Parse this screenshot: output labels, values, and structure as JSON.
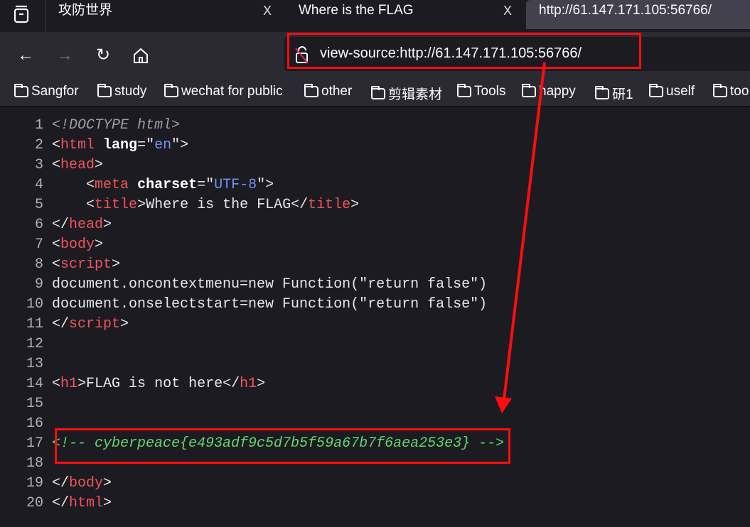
{
  "tabs": [
    {
      "title": "攻防世界",
      "active": false
    },
    {
      "title": "Where is the FLAG",
      "active": false
    },
    {
      "title": "http://61.147.171.105:56766/",
      "active": true
    }
  ],
  "tab_close_glyph": "X",
  "nav": {
    "back_icon": "arrow-left-icon",
    "forward_icon": "arrow-right-icon",
    "reload_icon": "reload-icon",
    "home_icon": "home-icon"
  },
  "address_bar": {
    "value": "view-source:http://61.147.171.105:56766/",
    "icon": "insecure-lock-icon"
  },
  "bookmarks": [
    "Sangfor",
    "study",
    "wechat for public",
    "other",
    "剪辑素材",
    "Tools",
    "happy",
    "研1",
    "uself",
    "too"
  ],
  "source_lines": [
    [
      [
        "doctype",
        "<!DOCTYPE html>"
      ]
    ],
    [
      [
        "punct",
        "<"
      ],
      [
        "tag",
        "html"
      ],
      [
        "text",
        " "
      ],
      [
        "attr",
        "lang"
      ],
      [
        "punct",
        "=\""
      ],
      [
        "val",
        "en"
      ],
      [
        "punct",
        "\">"
      ]
    ],
    [
      [
        "punct",
        "<"
      ],
      [
        "tag",
        "head"
      ],
      [
        "punct",
        ">"
      ]
    ],
    [
      [
        "text",
        "    "
      ],
      [
        "punct",
        "<"
      ],
      [
        "tag",
        "meta"
      ],
      [
        "text",
        " "
      ],
      [
        "attr",
        "charset"
      ],
      [
        "punct",
        "=\""
      ],
      [
        "val",
        "UTF-8"
      ],
      [
        "punct",
        "\">"
      ]
    ],
    [
      [
        "text",
        "    "
      ],
      [
        "punct",
        "<"
      ],
      [
        "tag",
        "title"
      ],
      [
        "punct",
        ">"
      ],
      [
        "text",
        "Where is the FLAG"
      ],
      [
        "punct",
        "</"
      ],
      [
        "tag",
        "title"
      ],
      [
        "punct",
        ">"
      ]
    ],
    [
      [
        "punct",
        "</"
      ],
      [
        "tag",
        "head"
      ],
      [
        "punct",
        ">"
      ]
    ],
    [
      [
        "punct",
        "<"
      ],
      [
        "tag",
        "body"
      ],
      [
        "punct",
        ">"
      ]
    ],
    [
      [
        "punct",
        "<"
      ],
      [
        "tag",
        "script"
      ],
      [
        "punct",
        ">"
      ]
    ],
    [
      [
        "text",
        "document.oncontextmenu=new Function(\"return false\")"
      ]
    ],
    [
      [
        "text",
        "document.onselectstart=new Function(\"return false\")"
      ]
    ],
    [
      [
        "punct",
        "</"
      ],
      [
        "tag",
        "script"
      ],
      [
        "punct",
        ">"
      ]
    ],
    [],
    [],
    [
      [
        "punct",
        "<"
      ],
      [
        "tag",
        "h1"
      ],
      [
        "punct",
        ">"
      ],
      [
        "text",
        "FLAG is not here"
      ],
      [
        "punct",
        "</"
      ],
      [
        "tag",
        "h1"
      ],
      [
        "punct",
        ">"
      ]
    ],
    [],
    [],
    [
      [
        "comment",
        "<!-- cyberpeace{e493adf9c5d7b5f59a67b7f6aea253e3} -->"
      ]
    ],
    [],
    [
      [
        "punct",
        "</"
      ],
      [
        "tag",
        "body"
      ],
      [
        "punct",
        ">"
      ]
    ],
    [
      [
        "punct",
        "</"
      ],
      [
        "tag",
        "html"
      ],
      [
        "punct",
        ">"
      ]
    ]
  ],
  "annotation_color": "#ff0d0d"
}
